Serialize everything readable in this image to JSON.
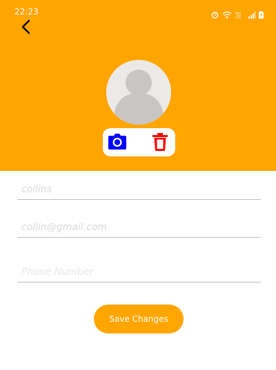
{
  "status_bar": {
    "time": "22:23",
    "icons": [
      "alarm-icon",
      "wifi-icon",
      "volte-icon",
      "signal-icon",
      "battery-charging-icon"
    ],
    "volte_label": "Vo) LTE"
  },
  "header": {
    "background_color": "#FFA500",
    "back_icon": "chevron-left-icon",
    "avatar_icon": "default-user-avatar",
    "actions": {
      "camera_icon": "camera-icon",
      "camera_color": "#0000FF",
      "delete_icon": "trash-icon",
      "delete_color": "#FF0000"
    }
  },
  "form": {
    "name": {
      "value": "collins",
      "placeholder": ""
    },
    "email": {
      "value": "collin@gmail.com",
      "placeholder": ""
    },
    "phone": {
      "value": "",
      "placeholder": "Phone Number"
    }
  },
  "save_button": {
    "label": "Save Changes",
    "color": "#FFA500"
  }
}
